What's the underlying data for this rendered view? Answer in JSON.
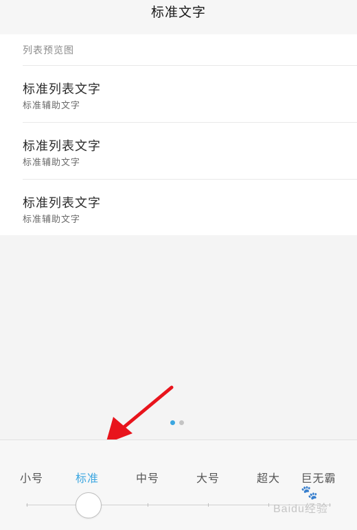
{
  "header": {
    "title": "标准文字"
  },
  "preview": {
    "section_label": "列表预览图",
    "items": [
      {
        "primary": "标准列表文字",
        "secondary": "标准辅助文字"
      },
      {
        "primary": "标准列表文字",
        "secondary": "标准辅助文字"
      },
      {
        "primary": "标准列表文字",
        "secondary": "标准辅助文字"
      }
    ]
  },
  "pager": {
    "active_color": "#3ba6e0",
    "inactive_color": "#c4c4c4",
    "active_index": 0,
    "count": 2
  },
  "annotation": {
    "arrow_color": "#e8141c"
  },
  "font_size_selector": {
    "options": [
      "小号",
      "标准",
      "中号",
      "大号",
      "超大",
      "巨无霸"
    ],
    "selected": "标准",
    "accent_color": "#3ba6e0"
  },
  "watermark": {
    "text": "Baidu经验"
  }
}
